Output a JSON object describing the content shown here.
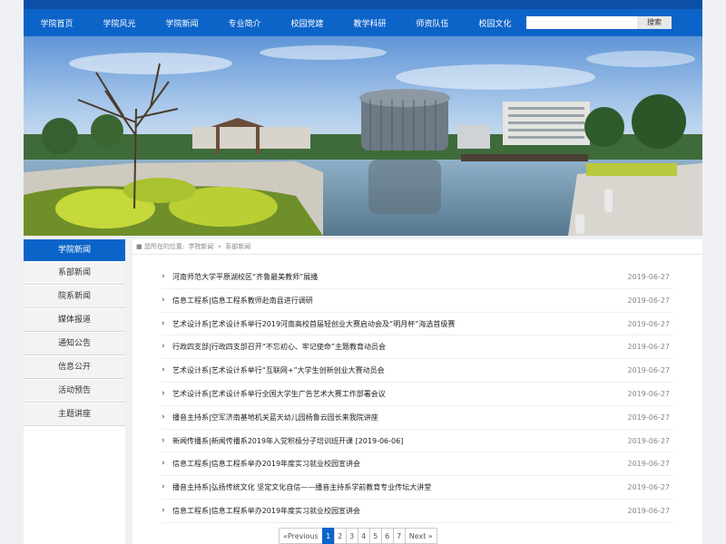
{
  "nav": {
    "items": [
      "学院首页",
      "学院风光",
      "学院新闻",
      "专业简介",
      "校园党建",
      "教学科研",
      "师资队伍",
      "校园文化"
    ],
    "search_placeholder": "",
    "search_button": "搜索"
  },
  "sidebar": {
    "heading": "学院新闻",
    "items": [
      "系部新闻",
      "院系新闻",
      "媒体报道",
      "通知公告",
      "信息公开",
      "活动预告",
      "主题讲座"
    ]
  },
  "breadcrumb": {
    "prefix": "■ 您所在的位置:",
    "link": "学院新闻",
    "separator": "»",
    "current": "系部新闻"
  },
  "news": [
    {
      "title": "河南师范大学平原湖校区“齐鲁最美教师”展播",
      "date": "2019-06-27"
    },
    {
      "title": "信息工程系|信息工程系教师赴南县进行调研",
      "date": "2019-06-27"
    },
    {
      "title": "艺术设计系|艺术设计系举行2019河南高校首届轻创业大赛启动会及“明月杯”海选首级赛",
      "date": "2019-06-27"
    },
    {
      "title": "行政四支部|行政四支部召开“不忘初心、牢记使命”主题教育动员会",
      "date": "2019-06-27"
    },
    {
      "title": "艺术设计系|艺术设计系举行“互联网+”大学生创新创业大赛动员会",
      "date": "2019-06-27"
    },
    {
      "title": "艺术设计系|艺术设计系举行全国大学生广告艺术大赛工作部署会议",
      "date": "2019-06-27"
    },
    {
      "title": "播音主持系|空军济南基地机关蓝天幼儿园杨鲁云园长来我院讲座",
      "date": "2019-06-27"
    },
    {
      "title": "新闻传播系|新闻传播系2019年入党积极分子培训班开课 [2019-06-06]",
      "date": "2019-06-27"
    },
    {
      "title": "信息工程系|信息工程系举办2019年度实习就业校园宣讲会",
      "date": "2019-06-27"
    },
    {
      "title": "播音主持系|弘扬传统文化 坚定文化自信——播音主持系学前教育专业传坛大讲堂",
      "date": "2019-06-27"
    },
    {
      "title": "信息工程系|信息工程系举办2019年度实习就业校园宣讲会",
      "date": "2019-06-27"
    }
  ],
  "pager": {
    "prev": "«Previous",
    "pages": [
      "1",
      "2",
      "3",
      "4",
      "5",
      "6",
      "7"
    ],
    "current": "1",
    "next": "Next »"
  }
}
